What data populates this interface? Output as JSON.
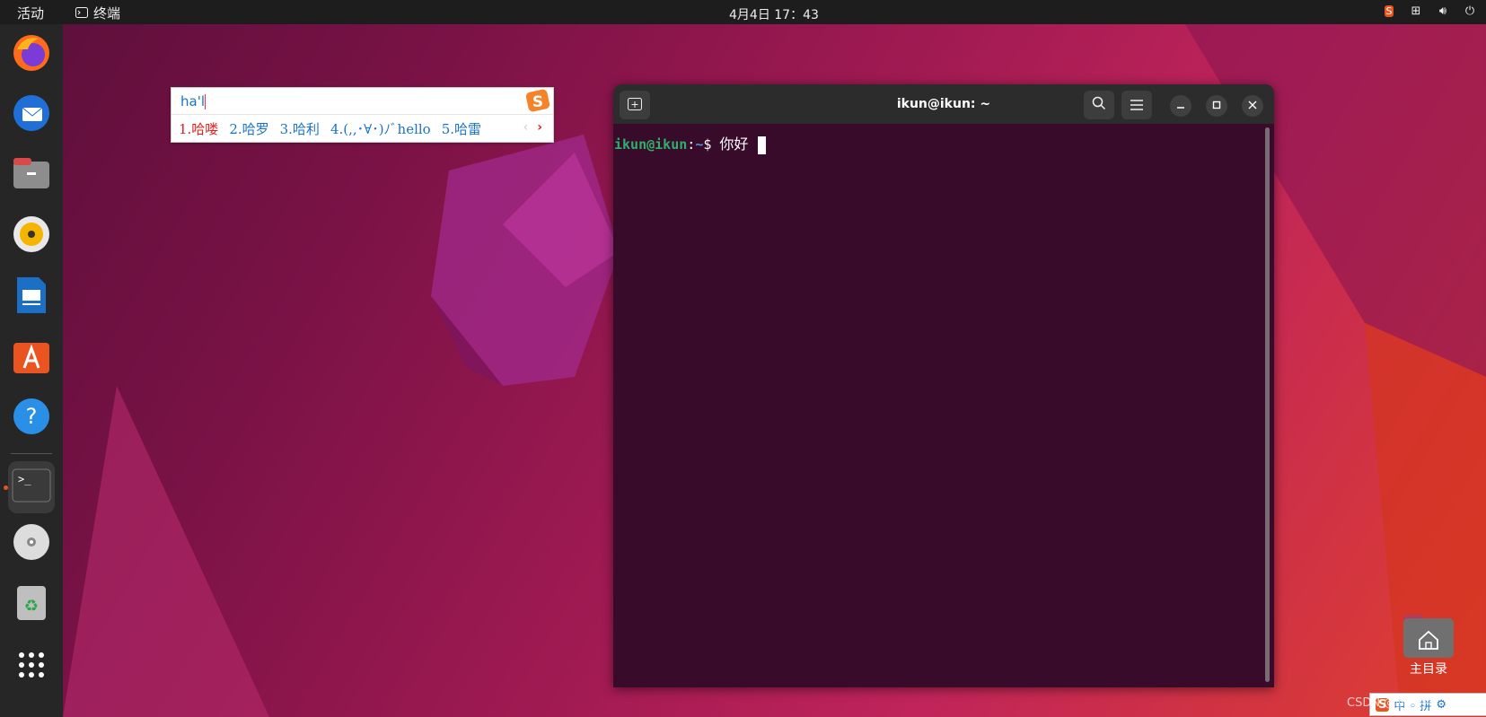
{
  "topbar": {
    "activities": "活动",
    "app_name": "终端",
    "clock": "4月4日  17：43"
  },
  "dock": {
    "items": [
      {
        "name": "firefox-icon"
      },
      {
        "name": "thunderbird-icon"
      },
      {
        "name": "files-icon"
      },
      {
        "name": "rhythmbox-icon"
      },
      {
        "name": "libreoffice-writer-icon"
      },
      {
        "name": "app-center-icon"
      },
      {
        "name": "help-icon"
      },
      {
        "name": "terminal-icon"
      },
      {
        "name": "disc-icon"
      },
      {
        "name": "trash-icon"
      },
      {
        "name": "show-apps-icon"
      }
    ]
  },
  "ime": {
    "input": "ha'l",
    "candidates": [
      "1.哈喽",
      "2.哈罗",
      "3.哈利",
      "4.(,,･∀･)ﾉﾞhello",
      "5.哈雷"
    ]
  },
  "terminal": {
    "title": "ikun@ikun: ~",
    "prompt_user": "ikun@ikun",
    "prompt_sep": ":",
    "prompt_path": "~",
    "prompt_symbol": "$",
    "command": "你好"
  },
  "desktop": {
    "home_label": "主目录",
    "watermark": "CSDN @鸥鸣手",
    "tray_ime_label": "中 ◦ 拼"
  },
  "colors": {
    "accent": "#e95420",
    "terminal_bg": "#380b2a",
    "prompt_user": "#2db06b",
    "prompt_path": "#5a8fe0",
    "ime_text": "#1a73c8",
    "ime_highlight": "#e0201c"
  }
}
